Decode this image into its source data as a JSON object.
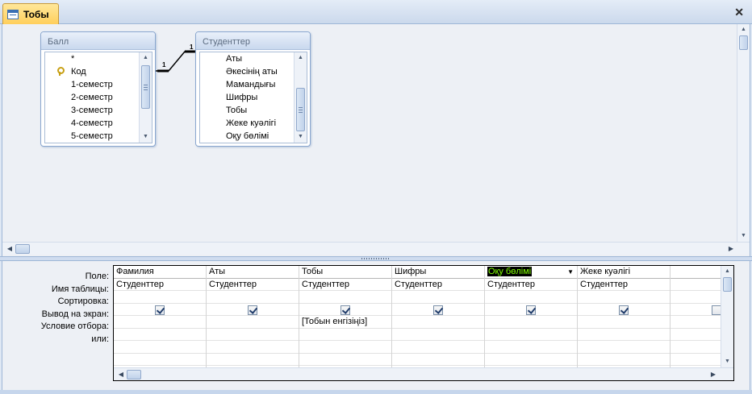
{
  "window": {
    "title": "Тобы",
    "close_glyph": "✕"
  },
  "relationship": {
    "left_label": "1",
    "right_label": "1"
  },
  "tables": [
    {
      "name": "Балл",
      "fields": [
        "*",
        "Код",
        "1-семестр",
        "2-семестр",
        "3-семестр",
        "4-семестр",
        "5-семестр"
      ],
      "key_field_index": 1
    },
    {
      "name": "Студенттер",
      "fields": [
        "Аты",
        "Әкесінің аты",
        "Мамандығы",
        "Шифры",
        "Тобы",
        "Жеке куәлігі",
        "Оқу бөлімі"
      ]
    }
  ],
  "grid": {
    "row_labels": [
      "Поле:",
      "Имя таблицы:",
      "Сортировка:",
      "Вывод на экран:",
      "Условие отбора:",
      "или:"
    ],
    "columns": [
      {
        "field": "Фамилия",
        "table": "Студенттер",
        "sort": "",
        "show": true,
        "criteria": ""
      },
      {
        "field": "Аты",
        "table": "Студенттер",
        "sort": "",
        "show": true,
        "criteria": ""
      },
      {
        "field": "Тобы",
        "table": "Студенттер",
        "sort": "",
        "show": true,
        "criteria": "[Тобын енгізіңіз]"
      },
      {
        "field": "Шифры",
        "table": "Студенттер",
        "sort": "",
        "show": true,
        "criteria": ""
      },
      {
        "field": "Оқу бөлімі",
        "table": "Студенттер",
        "sort": "",
        "show": true,
        "criteria": "",
        "selected": true
      },
      {
        "field": "Жеке куәлігі",
        "table": "Студенттер",
        "sort": "",
        "show": true,
        "criteria": ""
      },
      {
        "field": "",
        "table": "",
        "sort": "",
        "show": false,
        "criteria": ""
      }
    ]
  },
  "icons": {
    "scroll_up": "▲",
    "scroll_down": "▼",
    "scroll_left": "◀",
    "scroll_right": "▶",
    "dropdown": "▼",
    "query_tab_icon": "query-icon",
    "primary_key": "key-icon"
  },
  "colors": {
    "tab_active": "#ffd36b",
    "selection_bg": "#000000",
    "selection_fg": "#7fff00"
  }
}
